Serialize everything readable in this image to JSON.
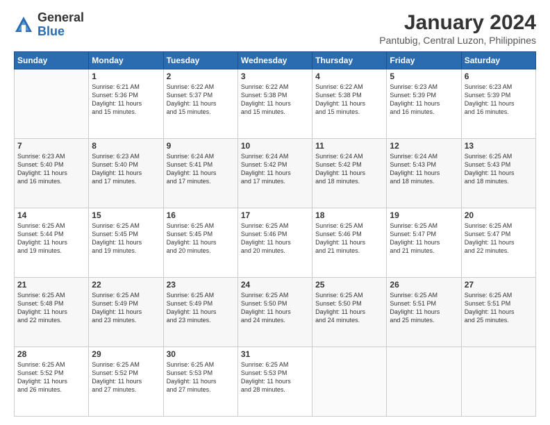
{
  "logo": {
    "general": "General",
    "blue": "Blue"
  },
  "title": "January 2024",
  "subtitle": "Pantubig, Central Luzon, Philippines",
  "days": [
    "Sunday",
    "Monday",
    "Tuesday",
    "Wednesday",
    "Thursday",
    "Friday",
    "Saturday"
  ],
  "weeks": [
    [
      {
        "day": "",
        "info": ""
      },
      {
        "day": "1",
        "info": "Sunrise: 6:21 AM\nSunset: 5:36 PM\nDaylight: 11 hours\nand 15 minutes."
      },
      {
        "day": "2",
        "info": "Sunrise: 6:22 AM\nSunset: 5:37 PM\nDaylight: 11 hours\nand 15 minutes."
      },
      {
        "day": "3",
        "info": "Sunrise: 6:22 AM\nSunset: 5:38 PM\nDaylight: 11 hours\nand 15 minutes."
      },
      {
        "day": "4",
        "info": "Sunrise: 6:22 AM\nSunset: 5:38 PM\nDaylight: 11 hours\nand 15 minutes."
      },
      {
        "day": "5",
        "info": "Sunrise: 6:23 AM\nSunset: 5:39 PM\nDaylight: 11 hours\nand 16 minutes."
      },
      {
        "day": "6",
        "info": "Sunrise: 6:23 AM\nSunset: 5:39 PM\nDaylight: 11 hours\nand 16 minutes."
      }
    ],
    [
      {
        "day": "7",
        "info": "Sunrise: 6:23 AM\nSunset: 5:40 PM\nDaylight: 11 hours\nand 16 minutes."
      },
      {
        "day": "8",
        "info": "Sunrise: 6:23 AM\nSunset: 5:40 PM\nDaylight: 11 hours\nand 17 minutes."
      },
      {
        "day": "9",
        "info": "Sunrise: 6:24 AM\nSunset: 5:41 PM\nDaylight: 11 hours\nand 17 minutes."
      },
      {
        "day": "10",
        "info": "Sunrise: 6:24 AM\nSunset: 5:42 PM\nDaylight: 11 hours\nand 17 minutes."
      },
      {
        "day": "11",
        "info": "Sunrise: 6:24 AM\nSunset: 5:42 PM\nDaylight: 11 hours\nand 18 minutes."
      },
      {
        "day": "12",
        "info": "Sunrise: 6:24 AM\nSunset: 5:43 PM\nDaylight: 11 hours\nand 18 minutes."
      },
      {
        "day": "13",
        "info": "Sunrise: 6:25 AM\nSunset: 5:43 PM\nDaylight: 11 hours\nand 18 minutes."
      }
    ],
    [
      {
        "day": "14",
        "info": "Sunrise: 6:25 AM\nSunset: 5:44 PM\nDaylight: 11 hours\nand 19 minutes."
      },
      {
        "day": "15",
        "info": "Sunrise: 6:25 AM\nSunset: 5:45 PM\nDaylight: 11 hours\nand 19 minutes."
      },
      {
        "day": "16",
        "info": "Sunrise: 6:25 AM\nSunset: 5:45 PM\nDaylight: 11 hours\nand 20 minutes."
      },
      {
        "day": "17",
        "info": "Sunrise: 6:25 AM\nSunset: 5:46 PM\nDaylight: 11 hours\nand 20 minutes."
      },
      {
        "day": "18",
        "info": "Sunrise: 6:25 AM\nSunset: 5:46 PM\nDaylight: 11 hours\nand 21 minutes."
      },
      {
        "day": "19",
        "info": "Sunrise: 6:25 AM\nSunset: 5:47 PM\nDaylight: 11 hours\nand 21 minutes."
      },
      {
        "day": "20",
        "info": "Sunrise: 6:25 AM\nSunset: 5:47 PM\nDaylight: 11 hours\nand 22 minutes."
      }
    ],
    [
      {
        "day": "21",
        "info": "Sunrise: 6:25 AM\nSunset: 5:48 PM\nDaylight: 11 hours\nand 22 minutes."
      },
      {
        "day": "22",
        "info": "Sunrise: 6:25 AM\nSunset: 5:49 PM\nDaylight: 11 hours\nand 23 minutes."
      },
      {
        "day": "23",
        "info": "Sunrise: 6:25 AM\nSunset: 5:49 PM\nDaylight: 11 hours\nand 23 minutes."
      },
      {
        "day": "24",
        "info": "Sunrise: 6:25 AM\nSunset: 5:50 PM\nDaylight: 11 hours\nand 24 minutes."
      },
      {
        "day": "25",
        "info": "Sunrise: 6:25 AM\nSunset: 5:50 PM\nDaylight: 11 hours\nand 24 minutes."
      },
      {
        "day": "26",
        "info": "Sunrise: 6:25 AM\nSunset: 5:51 PM\nDaylight: 11 hours\nand 25 minutes."
      },
      {
        "day": "27",
        "info": "Sunrise: 6:25 AM\nSunset: 5:51 PM\nDaylight: 11 hours\nand 25 minutes."
      }
    ],
    [
      {
        "day": "28",
        "info": "Sunrise: 6:25 AM\nSunset: 5:52 PM\nDaylight: 11 hours\nand 26 minutes."
      },
      {
        "day": "29",
        "info": "Sunrise: 6:25 AM\nSunset: 5:52 PM\nDaylight: 11 hours\nand 27 minutes."
      },
      {
        "day": "30",
        "info": "Sunrise: 6:25 AM\nSunset: 5:53 PM\nDaylight: 11 hours\nand 27 minutes."
      },
      {
        "day": "31",
        "info": "Sunrise: 6:25 AM\nSunset: 5:53 PM\nDaylight: 11 hours\nand 28 minutes."
      },
      {
        "day": "",
        "info": ""
      },
      {
        "day": "",
        "info": ""
      },
      {
        "day": "",
        "info": ""
      }
    ]
  ]
}
